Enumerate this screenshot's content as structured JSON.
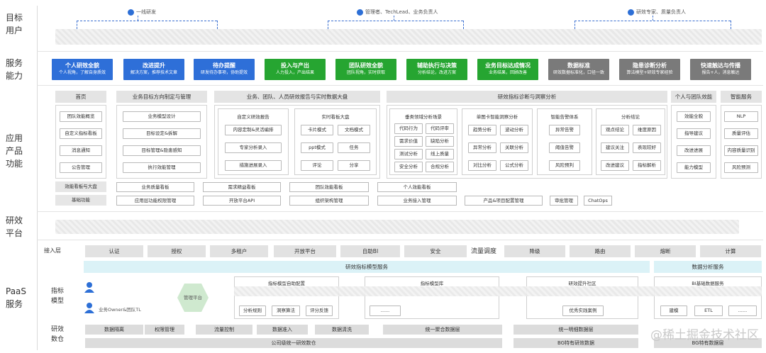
{
  "row_labels": {
    "target_users": [
      "目标",
      "用户"
    ],
    "service_ability": [
      "服务",
      "能力"
    ],
    "app_function": [
      "应用",
      "产品",
      "功能"
    ],
    "rd_platform": [
      "研效",
      "平台"
    ],
    "paas": [
      "PaaS",
      "服务"
    ]
  },
  "users": [
    {
      "label": "一线研发"
    },
    {
      "label": "管理者、TechLead、业务负责人"
    },
    {
      "label": "研效专家、质量负责人"
    }
  ],
  "services": [
    {
      "title": "个人研效全貌",
      "sub": "个人视角，了解自身质效",
      "color": "#2e6fd8"
    },
    {
      "title": "改进提升",
      "sub": "解决方案，推荐技术文章",
      "color": "#2e6fd8"
    },
    {
      "title": "待办提醒",
      "sub": "研发待办事项，协助提效",
      "color": "#2e6fd8"
    },
    {
      "title": "投入与产出",
      "sub": "人力投入，产出结果",
      "color": "#26a531"
    },
    {
      "title": "团队研效全貌",
      "sub": "团队视角，实时获取",
      "color": "#26a531"
    },
    {
      "title": "辅助执行与决策",
      "sub": "分析结论，改进方案",
      "color": "#26a531"
    },
    {
      "title": "业务目标达成情况",
      "sub": "业务结果，回顾改善",
      "color": "#26a531"
    },
    {
      "title": "数据标准",
      "sub": "研效数据标准化，口径一致",
      "color": "#7a7a7a"
    },
    {
      "title": "隐患诊断分析",
      "sub": "算法模型+研效专家经验",
      "color": "#7a7a7a"
    },
    {
      "title": "快速触达与传播",
      "sub": "报告+人，消息触达",
      "color": "#7a7a7a"
    }
  ],
  "headers": {
    "home": "首页",
    "goal": "业务目标方向制定与管理",
    "report": "业务、团队、人员研效报告与实时数据大盘",
    "diagnosis": "研效指标诊断与洞察分析",
    "personal": "个人与团队效能",
    "smart": "智能服务"
  },
  "home_items": [
    "团队效能概览",
    "自定义指标看板",
    "消息通知",
    "公告管理"
  ],
  "goal_items": [
    "业务模型设计",
    "目标设定&拆解",
    "目标管理&隐患感知",
    "执行效能管理"
  ],
  "custom_report": {
    "title": "自定义研效报告",
    "items": [
      "内容定制&灵活编排",
      "专家分析录入",
      "措施进展录入"
    ]
  },
  "realtime_board": {
    "title": "实时看板大盘",
    "items": [
      "卡片模式",
      "文档模式",
      "ppt模式",
      "任务",
      "评论",
      "分享"
    ]
  },
  "dimension_analysis": {
    "title": "垂类领域分析场景",
    "items": [
      "代码行为",
      "代码评审",
      "需求价值",
      "缺陷分析",
      "测试分析",
      "线上质量",
      "安全分析",
      "合规分析"
    ]
  },
  "single_card": {
    "title": "单图卡智能洞察分析",
    "items": [
      "趋势分析",
      "波动分析",
      "异常分析",
      "关联分析",
      "对比分析",
      "公式分析"
    ]
  },
  "alert_system": {
    "title": "智能告警体系",
    "items": [
      "异常告警",
      "阈值告警",
      "风险预判"
    ]
  },
  "analysis_conclusion": {
    "title": "分析结论",
    "items": [
      "观点结论",
      "维度原因",
      "建议关注",
      "表现较好",
      "改进建议",
      "指标解析"
    ]
  },
  "personal_items": [
    "效能全貌",
    "指导建议",
    "改进进展",
    "能力模型"
  ],
  "smart_items": [
    "NLP",
    "质量评估",
    "内容质量识别",
    "风险预测"
  ],
  "board_row": {
    "label": "效能看板与大盘",
    "items": [
      "业务质量看板",
      "需求精益看板",
      "团队效能看板",
      "个人效能看板"
    ]
  },
  "basic_row": {
    "label": "基础功能",
    "items": [
      "应用层功能权限管理",
      "开放平台API",
      "组织架构管理",
      "业务接入管理",
      "产品&项目配置管理",
      "审批管理",
      "ChatOps"
    ]
  },
  "access_layer": {
    "label": "接入层",
    "items": [
      "认证",
      "授权",
      "多租户",
      "开放平台",
      "自助BI",
      "安全"
    ],
    "flow_label": "流量调度",
    "flow_items": [
      "降级",
      "路由",
      "熔断",
      "计算"
    ]
  },
  "model_service": "研效指标模型服务",
  "data_analysis_service": "数据分析服务",
  "indicator_model": {
    "label": [
      "指标",
      "模型"
    ],
    "owner_label": "业务Owner&团队TL",
    "platform_label": "管理平台",
    "auto_config": "指标模型自助配置",
    "auto_items": [
      "分析规则",
      "洞察算法",
      "评分反馈"
    ],
    "library": "指标模型库",
    "library_item": "......",
    "community": "研效提升社区",
    "community_item": "优秀实践案例",
    "bi": "BI基础数据服务",
    "bi_items": [
      "建模",
      "ETL",
      "......"
    ]
  },
  "rd_data": {
    "label": [
      "研效",
      "数仓"
    ],
    "items": [
      "数据隔离",
      "权限管理",
      "流量控制",
      "数据准入",
      "数据清洗"
    ],
    "unified_agg": "统一聚合数据层",
    "unified_detail": "统一明细数据层",
    "company_base": "公司级统一研效数仓",
    "bg_data": "BG特有研效数据",
    "bg_base": "BG特有数据层"
  },
  "watermark": "@稀土掘金技术社区"
}
